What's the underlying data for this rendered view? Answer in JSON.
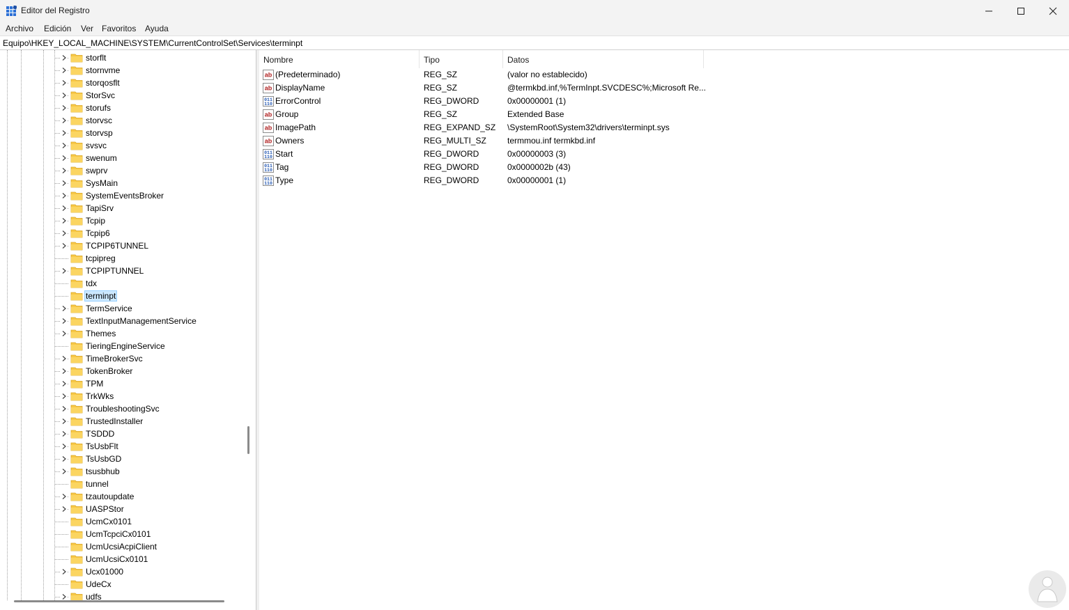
{
  "window": {
    "title": "Editor del Registro",
    "icon": "regedit-icon"
  },
  "menu": [
    "Archivo",
    "Edición",
    "Ver",
    "Favoritos",
    "Ayuda"
  ],
  "address": "Equipo\\HKEY_LOCAL_MACHINE\\SYSTEM\\CurrentControlSet\\Services\\terminpt",
  "tree": [
    {
      "label": "storflt",
      "expandable": true
    },
    {
      "label": "stornvme",
      "expandable": true
    },
    {
      "label": "storqosflt",
      "expandable": true
    },
    {
      "label": "StorSvc",
      "expandable": true
    },
    {
      "label": "storufs",
      "expandable": true
    },
    {
      "label": "storvsc",
      "expandable": true
    },
    {
      "label": "storvsp",
      "expandable": true
    },
    {
      "label": "svsvc",
      "expandable": true
    },
    {
      "label": "swenum",
      "expandable": true
    },
    {
      "label": "swprv",
      "expandable": true
    },
    {
      "label": "SysMain",
      "expandable": true
    },
    {
      "label": "SystemEventsBroker",
      "expandable": true
    },
    {
      "label": "TapiSrv",
      "expandable": true
    },
    {
      "label": "Tcpip",
      "expandable": true
    },
    {
      "label": "Tcpip6",
      "expandable": true
    },
    {
      "label": "TCPIP6TUNNEL",
      "expandable": true
    },
    {
      "label": "tcpipreg",
      "expandable": false
    },
    {
      "label": "TCPIPTUNNEL",
      "expandable": true
    },
    {
      "label": "tdx",
      "expandable": false
    },
    {
      "label": "terminpt",
      "expandable": false,
      "selected": true
    },
    {
      "label": "TermService",
      "expandable": true
    },
    {
      "label": "TextInputManagementService",
      "expandable": true
    },
    {
      "label": "Themes",
      "expandable": true
    },
    {
      "label": "TieringEngineService",
      "expandable": false
    },
    {
      "label": "TimeBrokerSvc",
      "expandable": true
    },
    {
      "label": "TokenBroker",
      "expandable": true
    },
    {
      "label": "TPM",
      "expandable": true
    },
    {
      "label": "TrkWks",
      "expandable": true
    },
    {
      "label": "TroubleshootingSvc",
      "expandable": true
    },
    {
      "label": "TrustedInstaller",
      "expandable": true
    },
    {
      "label": "TSDDD",
      "expandable": true
    },
    {
      "label": "TsUsbFlt",
      "expandable": true
    },
    {
      "label": "TsUsbGD",
      "expandable": true
    },
    {
      "label": "tsusbhub",
      "expandable": true
    },
    {
      "label": "tunnel",
      "expandable": false
    },
    {
      "label": "tzautoupdate",
      "expandable": true
    },
    {
      "label": "UASPStor",
      "expandable": true
    },
    {
      "label": "UcmCx0101",
      "expandable": false
    },
    {
      "label": "UcmTcpciCx0101",
      "expandable": false
    },
    {
      "label": "UcmUcsiAcpiClient",
      "expandable": false
    },
    {
      "label": "UcmUcsiCx0101",
      "expandable": false
    },
    {
      "label": "Ucx01000",
      "expandable": true
    },
    {
      "label": "UdeCx",
      "expandable": false
    },
    {
      "label": "udfs",
      "expandable": true
    }
  ],
  "columns": [
    "Nombre",
    "Tipo",
    "Datos"
  ],
  "values": [
    {
      "icon": "string-value-icon",
      "name": "(Predeterminado)",
      "type": "REG_SZ",
      "data": "(valor no establecido)"
    },
    {
      "icon": "string-value-icon",
      "name": "DisplayName",
      "type": "REG_SZ",
      "data": "@termkbd.inf,%TermInpt.SVCDESC%;Microsoft Re..."
    },
    {
      "icon": "binary-value-icon",
      "name": "ErrorControl",
      "type": "REG_DWORD",
      "data": "0x00000001 (1)"
    },
    {
      "icon": "string-value-icon",
      "name": "Group",
      "type": "REG_SZ",
      "data": "Extended Base"
    },
    {
      "icon": "string-value-icon",
      "name": "ImagePath",
      "type": "REG_EXPAND_SZ",
      "data": "\\SystemRoot\\System32\\drivers\\terminpt.sys"
    },
    {
      "icon": "string-value-icon",
      "name": "Owners",
      "type": "REG_MULTI_SZ",
      "data": "termmou.inf termkbd.inf"
    },
    {
      "icon": "binary-value-icon",
      "name": "Start",
      "type": "REG_DWORD",
      "data": "0x00000003 (3)"
    },
    {
      "icon": "binary-value-icon",
      "name": "Tag",
      "type": "REG_DWORD",
      "data": "0x0000002b (43)"
    },
    {
      "icon": "binary-value-icon",
      "name": "Type",
      "type": "REG_DWORD",
      "data": "0x00000001 (1)"
    }
  ],
  "colors": {
    "chrome": "#f3f3f3",
    "folder": "#f8c847",
    "selection": "#cce8ff",
    "selection_border": "#99d1ff",
    "string_icon": "#b02020",
    "binary_icon": "#2458b3"
  }
}
